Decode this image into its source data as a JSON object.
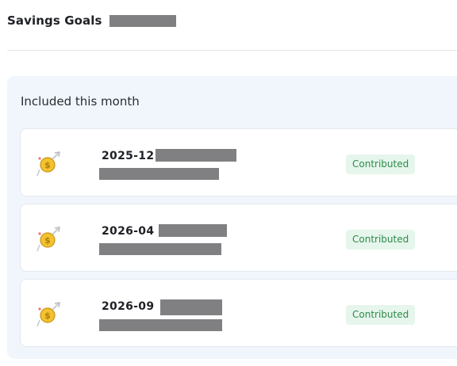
{
  "header": {
    "title": "Savings Goals"
  },
  "section": {
    "title": "Included this month"
  },
  "goals": [
    {
      "month": "2025-12",
      "icon": "money-bag-flying-icon",
      "status": "Contributed"
    },
    {
      "month": "2026-04",
      "icon": "money-bag-flying-icon",
      "status": "Contributed"
    },
    {
      "month": "2026-09",
      "icon": "money-bag-flying-icon",
      "status": "Contributed"
    }
  ],
  "colors": {
    "panel_bg": "#f1f6fd",
    "badge_bg": "#e6f6ec",
    "badge_text": "#2e8a4a",
    "redaction": "#808083"
  }
}
